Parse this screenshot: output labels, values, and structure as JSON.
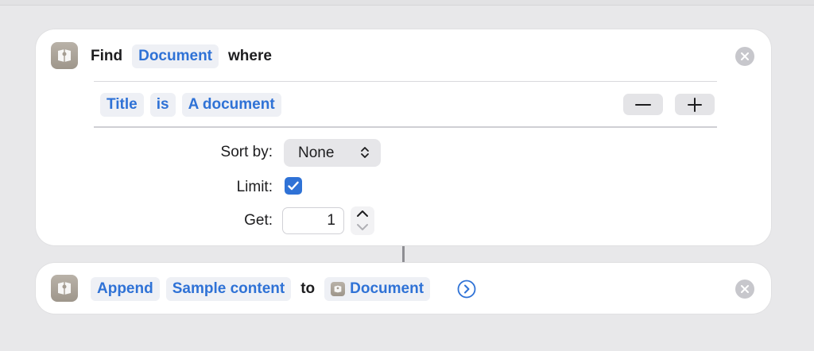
{
  "find_action": {
    "find_word": "Find",
    "entity_token": "Document",
    "where_word": "where",
    "filter": {
      "field": "Title",
      "operator": "is",
      "value": "A document"
    },
    "sort_by": {
      "label": "Sort by:",
      "value": "None"
    },
    "limit": {
      "label": "Limit:",
      "checked": true
    },
    "get": {
      "label": "Get:",
      "value": "1"
    }
  },
  "append_action": {
    "verb_token": "Append",
    "content_token": "Sample content",
    "to_word": "to",
    "target_token": "Document"
  },
  "colors": {
    "accent": "#2f72d6",
    "token_background": "#eef0f5",
    "card_background": "#ffffff",
    "canvas_background": "#e8e8ea",
    "app_icon": "#aaa296"
  },
  "icons": {
    "app": "document-app-icon",
    "close": "close-icon",
    "remove": "minus-icon",
    "add": "plus-icon",
    "popup": "updown-chevron-icon",
    "checkbox": "checkmark-icon",
    "stepper_up": "chevron-up-icon",
    "stepper_down": "chevron-down-icon",
    "expand": "chevron-right-circle-icon"
  }
}
